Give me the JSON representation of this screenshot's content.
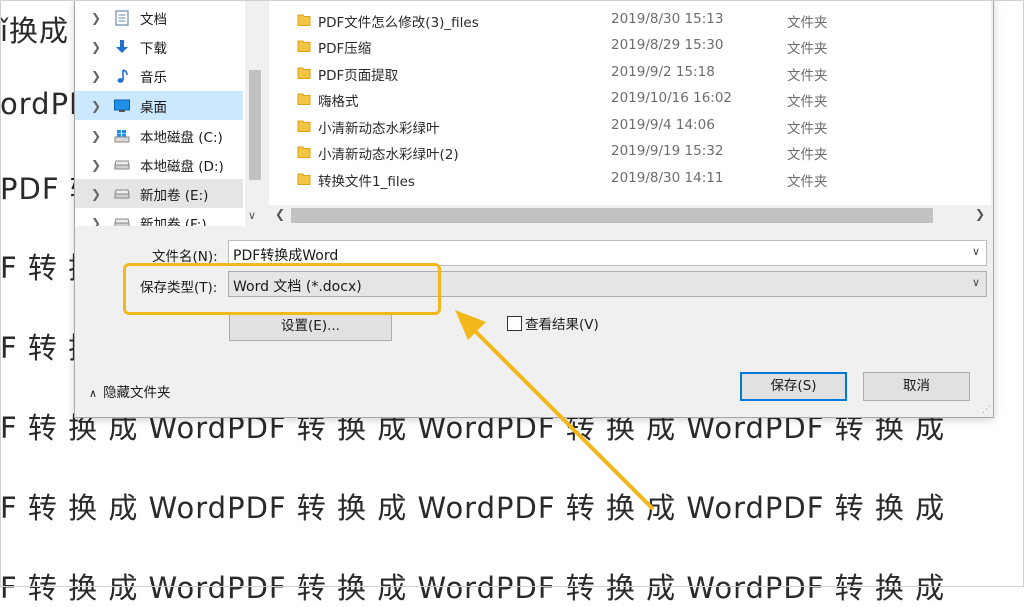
{
  "background_text": {
    "lines": [
      "ǐ换成 W",
      "ordPDF",
      "PDF 转",
      "F 转 换",
      "F 转 换",
      "F 转 换 成 WordPDF 转 换 成 WordPDF 转 换 成 WordPDF 转 换 成",
      "F 转 换 成 WordPDF 转 换 成 WordPDF 转 换 成 WordPDF 转 换 成",
      "F 转 换 成 WordPDF 转 换 成 WordPDF 转 换 成 WordPDF 转 换 成"
    ]
  },
  "nav_pane": {
    "items": [
      {
        "label": "文档",
        "icon": "document-icon"
      },
      {
        "label": "下载",
        "icon": "download-icon"
      },
      {
        "label": "音乐",
        "icon": "music-icon"
      },
      {
        "label": "桌面",
        "icon": "desktop-icon",
        "selected": true
      },
      {
        "label": "本地磁盘 (C:)",
        "icon": "windows-drive-icon"
      },
      {
        "label": "本地磁盘 (D:)",
        "icon": "drive-icon"
      },
      {
        "label": "新加卷 (E:)",
        "icon": "drive-icon",
        "hover": true
      },
      {
        "label": "新加卷 (F:)",
        "icon": "drive-icon"
      }
    ]
  },
  "files": [
    {
      "name": "PDF文件怎么修改(3)_files",
      "date": "2019/8/30 15:13",
      "type": "文件夹"
    },
    {
      "name": "PDF压缩",
      "date": "2019/8/29 15:30",
      "type": "文件夹"
    },
    {
      "name": "PDF页面提取",
      "date": "2019/9/2 15:18",
      "type": "文件夹"
    },
    {
      "name": "嗨格式",
      "date": "2019/10/16 16:02",
      "type": "文件夹"
    },
    {
      "name": "小清新动态水彩绿叶",
      "date": "2019/9/4 14:06",
      "type": "文件夹"
    },
    {
      "name": "小清新动态水彩绿叶(2)",
      "date": "2019/9/19 15:32",
      "type": "文件夹"
    },
    {
      "name": "转换文件1_files",
      "date": "2019/8/30 14:11",
      "type": "文件夹"
    }
  ],
  "form": {
    "filename_label": "文件名(N):",
    "filename_value": "PDF转换成Word",
    "filetype_label": "保存类型(T):",
    "filetype_value": "Word 文档 (*.docx)",
    "settings_button": "设置(E)...",
    "view_results_label": "查看结果(V)",
    "view_results_checked": false,
    "hide_folders_label": "隐藏文件夹",
    "save_button": "保存(S)",
    "cancel_button": "取消"
  },
  "colors": {
    "highlight": "#f2b81c",
    "selection": "#cce8ff",
    "accent": "#0078d7"
  }
}
